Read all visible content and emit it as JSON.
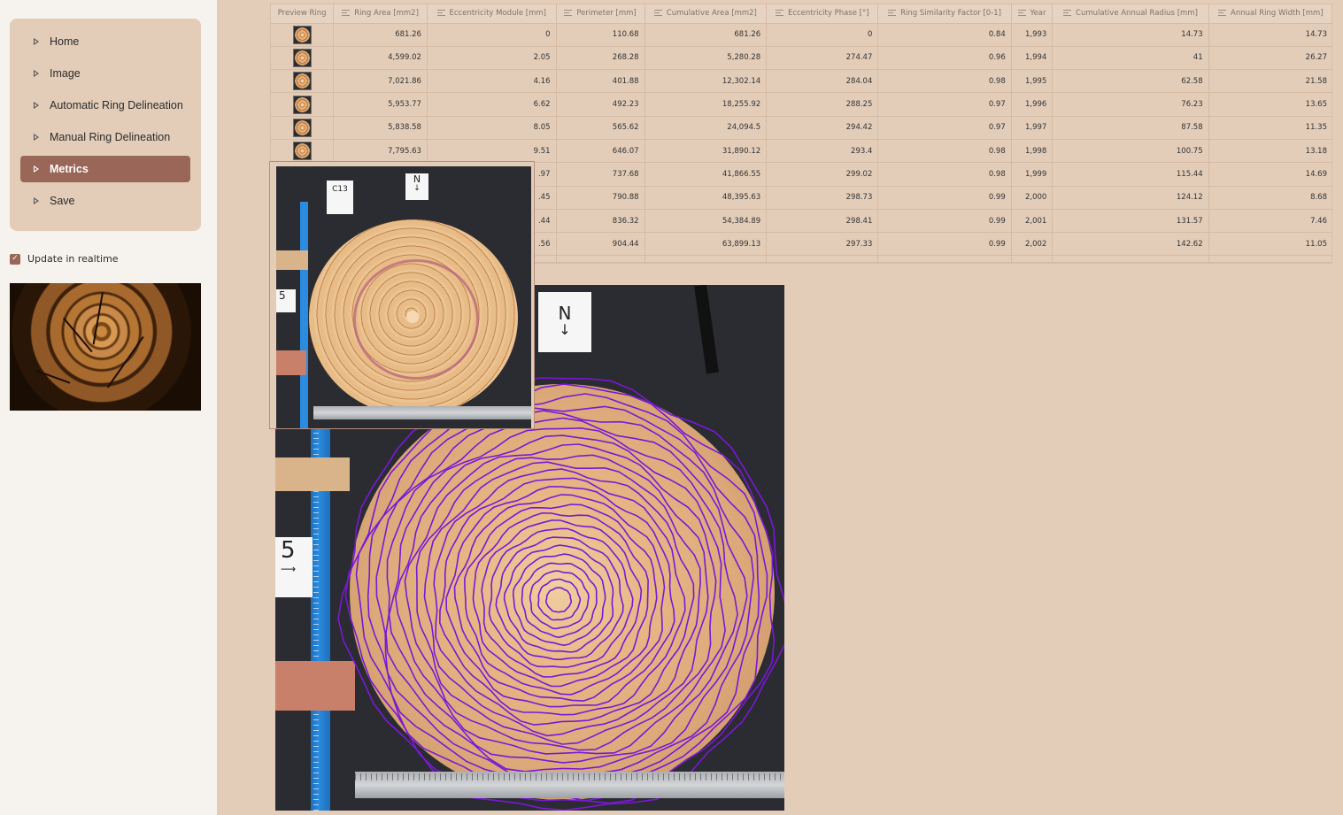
{
  "sidebar": {
    "nav": [
      {
        "label": "Home",
        "active": false
      },
      {
        "label": "Image",
        "active": false
      },
      {
        "label": "Automatic Ring Delineation",
        "active": false
      },
      {
        "label": "Manual Ring Delineation",
        "active": false
      },
      {
        "label": "Metrics",
        "active": true
      },
      {
        "label": "Save",
        "active": false
      }
    ],
    "realtime_label": "Update in realtime",
    "realtime_checked": true
  },
  "table": {
    "columns": [
      "Preview Ring",
      "Ring Area [mm2]",
      "Eccentricity Module [mm]",
      "Perimeter [mm]",
      "Cumulative Area [mm2]",
      "Eccentricity Phase [°]",
      "Ring Similarity Factor [0-1]",
      "Year",
      "Cumulative Annual Radius [mm]",
      "Annual Ring Width [mm]"
    ],
    "rows": [
      [
        "",
        "681.26",
        "0",
        "110.68",
        "681.26",
        "0",
        "0.84",
        "1,993",
        "14.73",
        "14.73"
      ],
      [
        "",
        "4,599.02",
        "2.05",
        "268.28",
        "5,280.28",
        "274.47",
        "0.96",
        "1,994",
        "41",
        "26.27"
      ],
      [
        "",
        "7,021.86",
        "4.16",
        "401.88",
        "12,302.14",
        "284.04",
        "0.98",
        "1,995",
        "62.58",
        "21.58"
      ],
      [
        "",
        "5,953.77",
        "6.62",
        "492.23",
        "18,255.92",
        "288.25",
        "0.97",
        "1,996",
        "76.23",
        "13.65"
      ],
      [
        "",
        "5,838.58",
        "8.05",
        "565.62",
        "24,094.5",
        "294.42",
        "0.97",
        "1,997",
        "87.58",
        "11.35"
      ],
      [
        "",
        "7,795.63",
        "9.51",
        "646.07",
        "31,890.12",
        "293.4",
        "0.98",
        "1,998",
        "100.75",
        "13.18"
      ],
      [
        "",
        "",
        ".97",
        "737.68",
        "41,866.55",
        "299.02",
        "0.98",
        "1,999",
        "115.44",
        "14.69"
      ],
      [
        "",
        "",
        ".45",
        "790.88",
        "48,395.63",
        "298.73",
        "0.99",
        "2,000",
        "124.12",
        "8.68"
      ],
      [
        "",
        "",
        ".44",
        "836.32",
        "54,384.89",
        "298.41",
        "0.99",
        "2,001",
        "131.57",
        "7.46"
      ],
      [
        "",
        "",
        ".56",
        "904.44",
        "63,899.13",
        "297.33",
        "0.99",
        "2,002",
        "142.62",
        "11.05"
      ]
    ]
  },
  "image": {
    "label_sample": "C13",
    "label_north": "N",
    "label_number": "5",
    "ring_color": "#7a18d6"
  }
}
